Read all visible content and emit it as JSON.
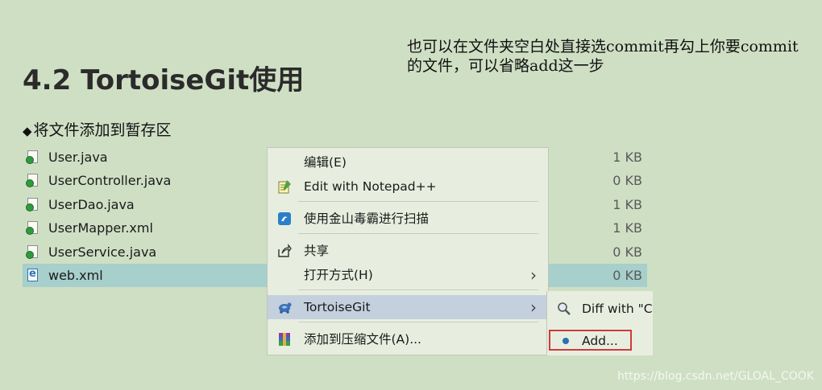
{
  "slide": {
    "title": "4.2 TortoiseGit使用",
    "note": "也可以在文件夹空白处直接选commit再勾上你要commit的文件，可以省略add这一步",
    "bullet_symbol": "◆",
    "bullet_text": "将文件添加到暂存区",
    "watermark": "https://blog.csdn.net/GLOAL_COOK"
  },
  "files": [
    {
      "name": "User.java",
      "size": "1 KB"
    },
    {
      "name": "UserController.java",
      "size": "0 KB"
    },
    {
      "name": "UserDao.java",
      "size": "1 KB"
    },
    {
      "name": "UserMapper.xml",
      "size": "1 KB"
    },
    {
      "name": "UserService.java",
      "size": "0 KB"
    },
    {
      "name": "web.xml",
      "size": "0 KB"
    }
  ],
  "context_menu": {
    "edit": "编辑(E)",
    "notepad": "Edit with Notepad++",
    "scan": "使用金山毒霸进行扫描",
    "share": "共享",
    "open_with": "打开方式(H)",
    "tortoisegit": "TortoiseGit",
    "compress": "添加到压缩文件(A)..."
  },
  "submenu": {
    "diff": "Diff with \"C",
    "add": "Add..."
  },
  "colors": {
    "background": "#cfdfc4",
    "selected_row": "#a7cfcb",
    "highlight": "#c4d0dd",
    "add_border": "#d03a3a"
  }
}
